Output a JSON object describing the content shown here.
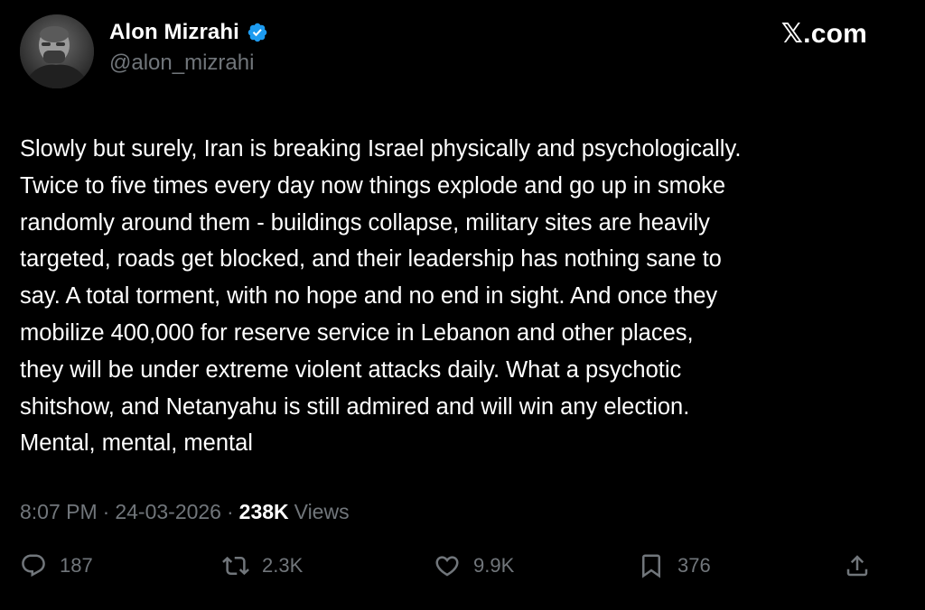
{
  "author": {
    "display_name": "Alon Mizrahi",
    "handle": "@alon_mizrahi",
    "verified": true,
    "avatar_icon": "profile-photo"
  },
  "brand": "𝕏.com",
  "tweet": {
    "text": "Slowly but surely, Iran is breaking Israel physically and psychologically.\nTwice to five times every day now things explode and go up in smoke\nrandomly around them - buildings collapse, military sites are heavily\ntargeted, roads get blocked, and their leadership has nothing sane to\nsay. A total torment, with no hope and no end in sight. And once they\nmobilize 400,000 for reserve service in Lebanon and other places,\nthey will be under extreme violent attacks daily. What a psychotic\nshitshow, and Netanyahu is still admired and will win any election.\nMental, mental, mental"
  },
  "meta": {
    "time": "8:07 PM",
    "separator": "·",
    "date": "24-03-2026",
    "views_count": "238K",
    "views_label": "Views"
  },
  "actions": {
    "replies": "187",
    "retweets": "2.3K",
    "likes": "9.9K",
    "bookmarks": "376"
  },
  "colors": {
    "background": "#000000",
    "text": "#ffffff",
    "muted": "#71767b",
    "verified": "#1d9bf0"
  }
}
